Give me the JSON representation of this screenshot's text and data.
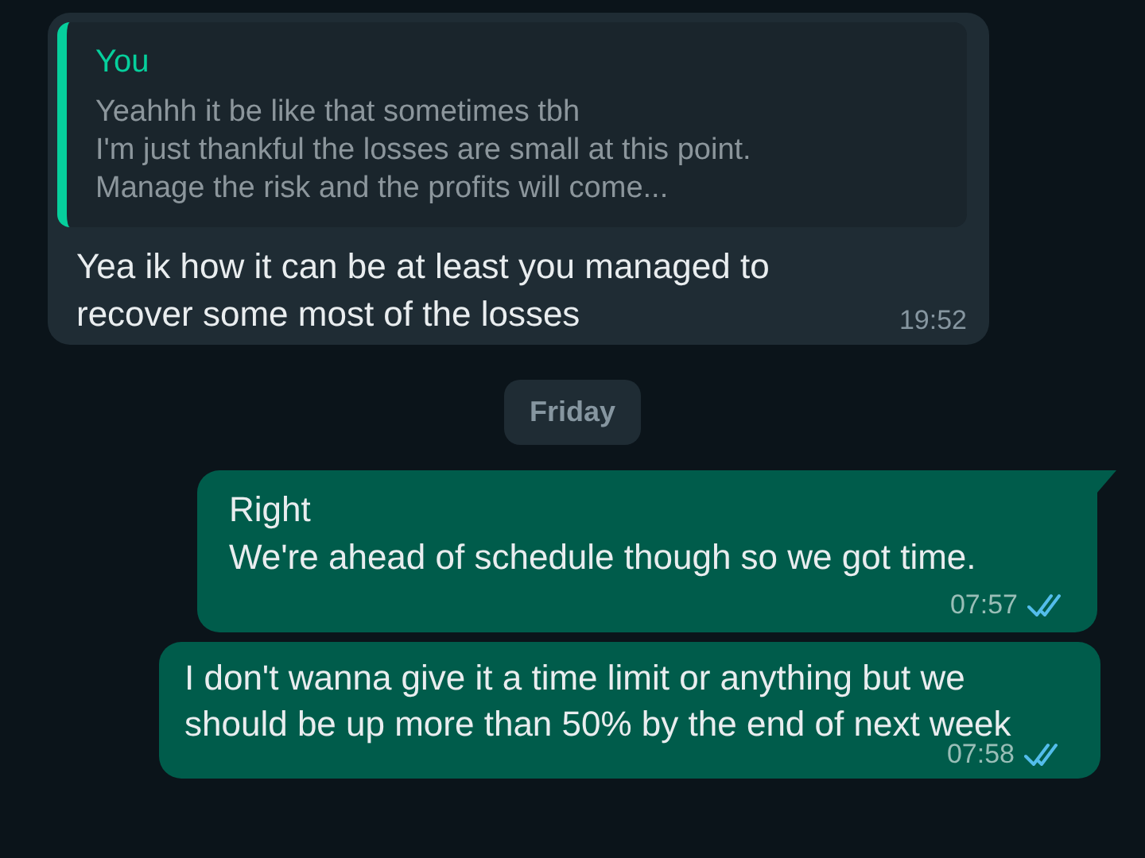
{
  "messages": [
    {
      "kind": "incoming",
      "quote": {
        "author": "You",
        "text": "Yeahhh it be like that sometimes tbh\nI'm just thankful the losses are small at this point.\nManage the risk and the profits will come..."
      },
      "text": "Yea ik how it can be at least you managed to recover some most of the losses",
      "time": "19:52"
    },
    {
      "kind": "date",
      "label": "Friday"
    },
    {
      "kind": "outgoing",
      "text": "Right\nWe're ahead of schedule though so we got time.",
      "time": "07:57",
      "read": true,
      "tail": true
    },
    {
      "kind": "outgoing",
      "text": "I don't wanna give it a time limit or anything but we should be up more than 50% by the end of next week",
      "time": "07:58",
      "read": true,
      "tail": false
    }
  ]
}
